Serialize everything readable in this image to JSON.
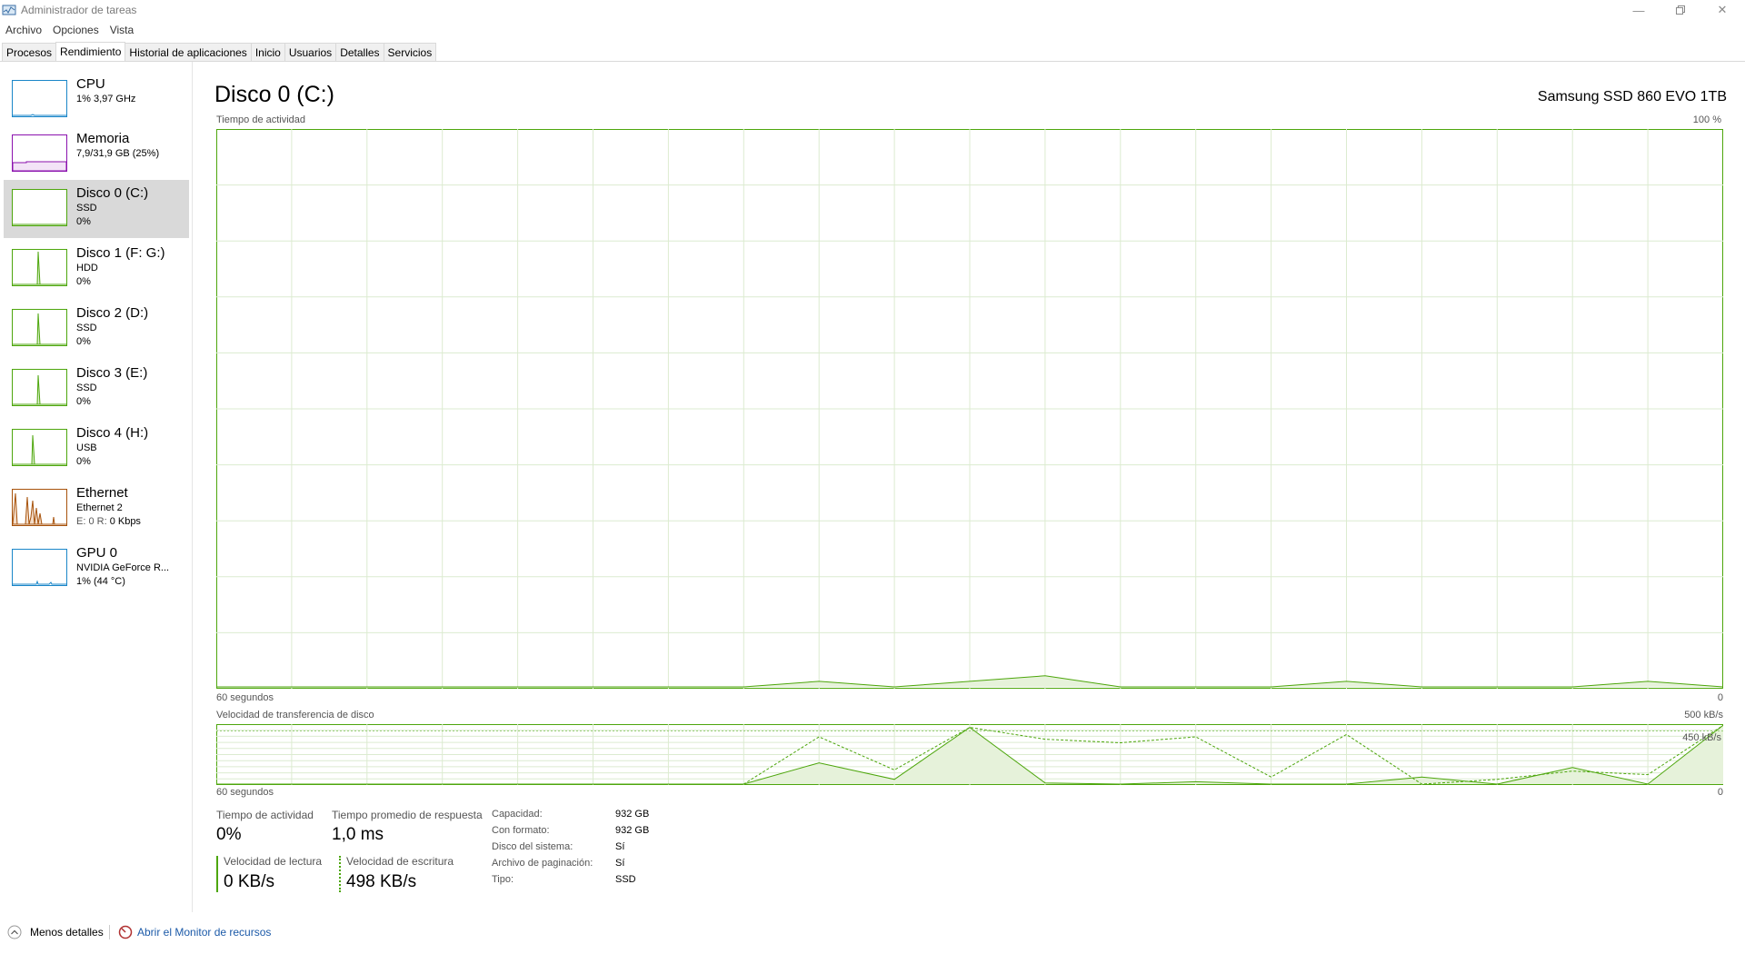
{
  "window": {
    "title": "Administrador de tareas"
  },
  "menu": [
    "Archivo",
    "Opciones",
    "Vista"
  ],
  "tabs": [
    {
      "label": "Procesos"
    },
    {
      "label": "Rendimiento"
    },
    {
      "label": "Historial de aplicaciones"
    },
    {
      "label": "Inicio"
    },
    {
      "label": "Usuarios"
    },
    {
      "label": "Detalles"
    },
    {
      "label": "Servicios"
    }
  ],
  "active_tab": "Rendimiento",
  "sidebar": {
    "items": [
      {
        "title": "CPU",
        "line1": "1% 3,97 GHz",
        "line2": "",
        "color": "#1a86c8"
      },
      {
        "title": "Memoria",
        "line1": "7,9/31,9 GB (25%)",
        "line2": "",
        "color": "#8b12ae"
      },
      {
        "title": "Disco 0 (C:)",
        "line1": "SSD",
        "line2": "0%",
        "color": "#4da60c"
      },
      {
        "title": "Disco 1 (F: G:)",
        "line1": "HDD",
        "line2": "0%",
        "color": "#4da60c"
      },
      {
        "title": "Disco 2 (D:)",
        "line1": "SSD",
        "line2": "0%",
        "color": "#4da60c"
      },
      {
        "title": "Disco 3 (E:)",
        "line1": "SSD",
        "line2": "0%",
        "color": "#4da60c"
      },
      {
        "title": "Disco 4 (H:)",
        "line1": "USB",
        "line2": "0%",
        "color": "#4da60c"
      },
      {
        "title": "Ethernet",
        "line1": "Ethernet 2",
        "line2a": "E: 0 R: ",
        "line2b": "0 Kbps",
        "color": "#a7520b"
      },
      {
        "title": "GPU 0",
        "line1": "NVIDIA GeForce R...",
        "line2": "1% (44 °C)",
        "color": "#1a86c8"
      }
    ]
  },
  "main": {
    "title": "Disco 0 (C:)",
    "device": "Samsung SSD 860 EVO 1TB",
    "activity_label": "Tiempo de actividad",
    "activity_max": "100 %",
    "time_left": "60 segundos",
    "time_right": "0",
    "transfer_label": "Velocidad de transferencia de disco",
    "transfer_max": "500 kB/s",
    "transfer_inner": "450 kB/s",
    "time_left2": "60 segundos",
    "time_right2": "0",
    "stats": {
      "activity_label": "Tiempo de actividad",
      "activity_value": "0%",
      "response_label": "Tiempo promedio de respuesta",
      "response_value": "1,0 ms",
      "read_label": "Velocidad de lectura",
      "read_value": "0 KB/s",
      "write_label": "Velocidad de escritura",
      "write_value": "498 KB/s"
    },
    "props": [
      {
        "label": "Capacidad:",
        "value": "932 GB"
      },
      {
        "label": "Con formato:",
        "value": "932 GB"
      },
      {
        "label": "Disco del sistema:",
        "value": "Sí"
      },
      {
        "label": "Archivo de paginación:",
        "value": "Sí"
      },
      {
        "label": "Tipo:",
        "value": "SSD"
      }
    ]
  },
  "footer": {
    "less_details": "Menos detalles",
    "resource_monitor": "Abrir el Monitor de recursos"
  },
  "chart_data": [
    {
      "type": "area",
      "title": "Tiempo de actividad",
      "xlabel": "60 segundos",
      "ylabel": "",
      "ylim": [
        0,
        100
      ],
      "x": [
        60,
        57,
        54,
        51,
        48,
        45,
        42,
        39,
        36,
        33,
        30,
        27,
        24,
        21,
        18,
        15,
        12,
        9,
        6,
        3,
        0
      ],
      "series": [
        {
          "values": [
            0,
            0,
            0,
            0,
            0,
            0,
            0,
            0,
            1,
            0,
            1,
            2,
            0,
            0,
            0,
            1,
            0,
            0,
            0,
            1,
            0
          ]
        }
      ]
    },
    {
      "type": "line",
      "title": "Velocidad de transferencia de disco",
      "xlabel": "60 segundos",
      "ylim": [
        0,
        500
      ],
      "x": [
        60,
        57,
        54,
        51,
        48,
        45,
        42,
        39,
        36,
        33,
        30,
        27,
        24,
        21,
        18,
        15,
        12,
        9,
        6,
        3,
        0
      ],
      "series": [
        {
          "values": [
            0,
            0,
            0,
            0,
            0,
            0,
            0,
            0,
            180,
            40,
            480,
            10,
            0,
            20,
            0,
            0,
            60,
            0,
            140,
            0,
            498
          ]
        },
        {
          "values": [
            0,
            0,
            0,
            0,
            0,
            0,
            0,
            0,
            400,
            120,
            480,
            380,
            350,
            400,
            60,
            420,
            0,
            40,
            110,
            80,
            498
          ]
        }
      ]
    }
  ]
}
